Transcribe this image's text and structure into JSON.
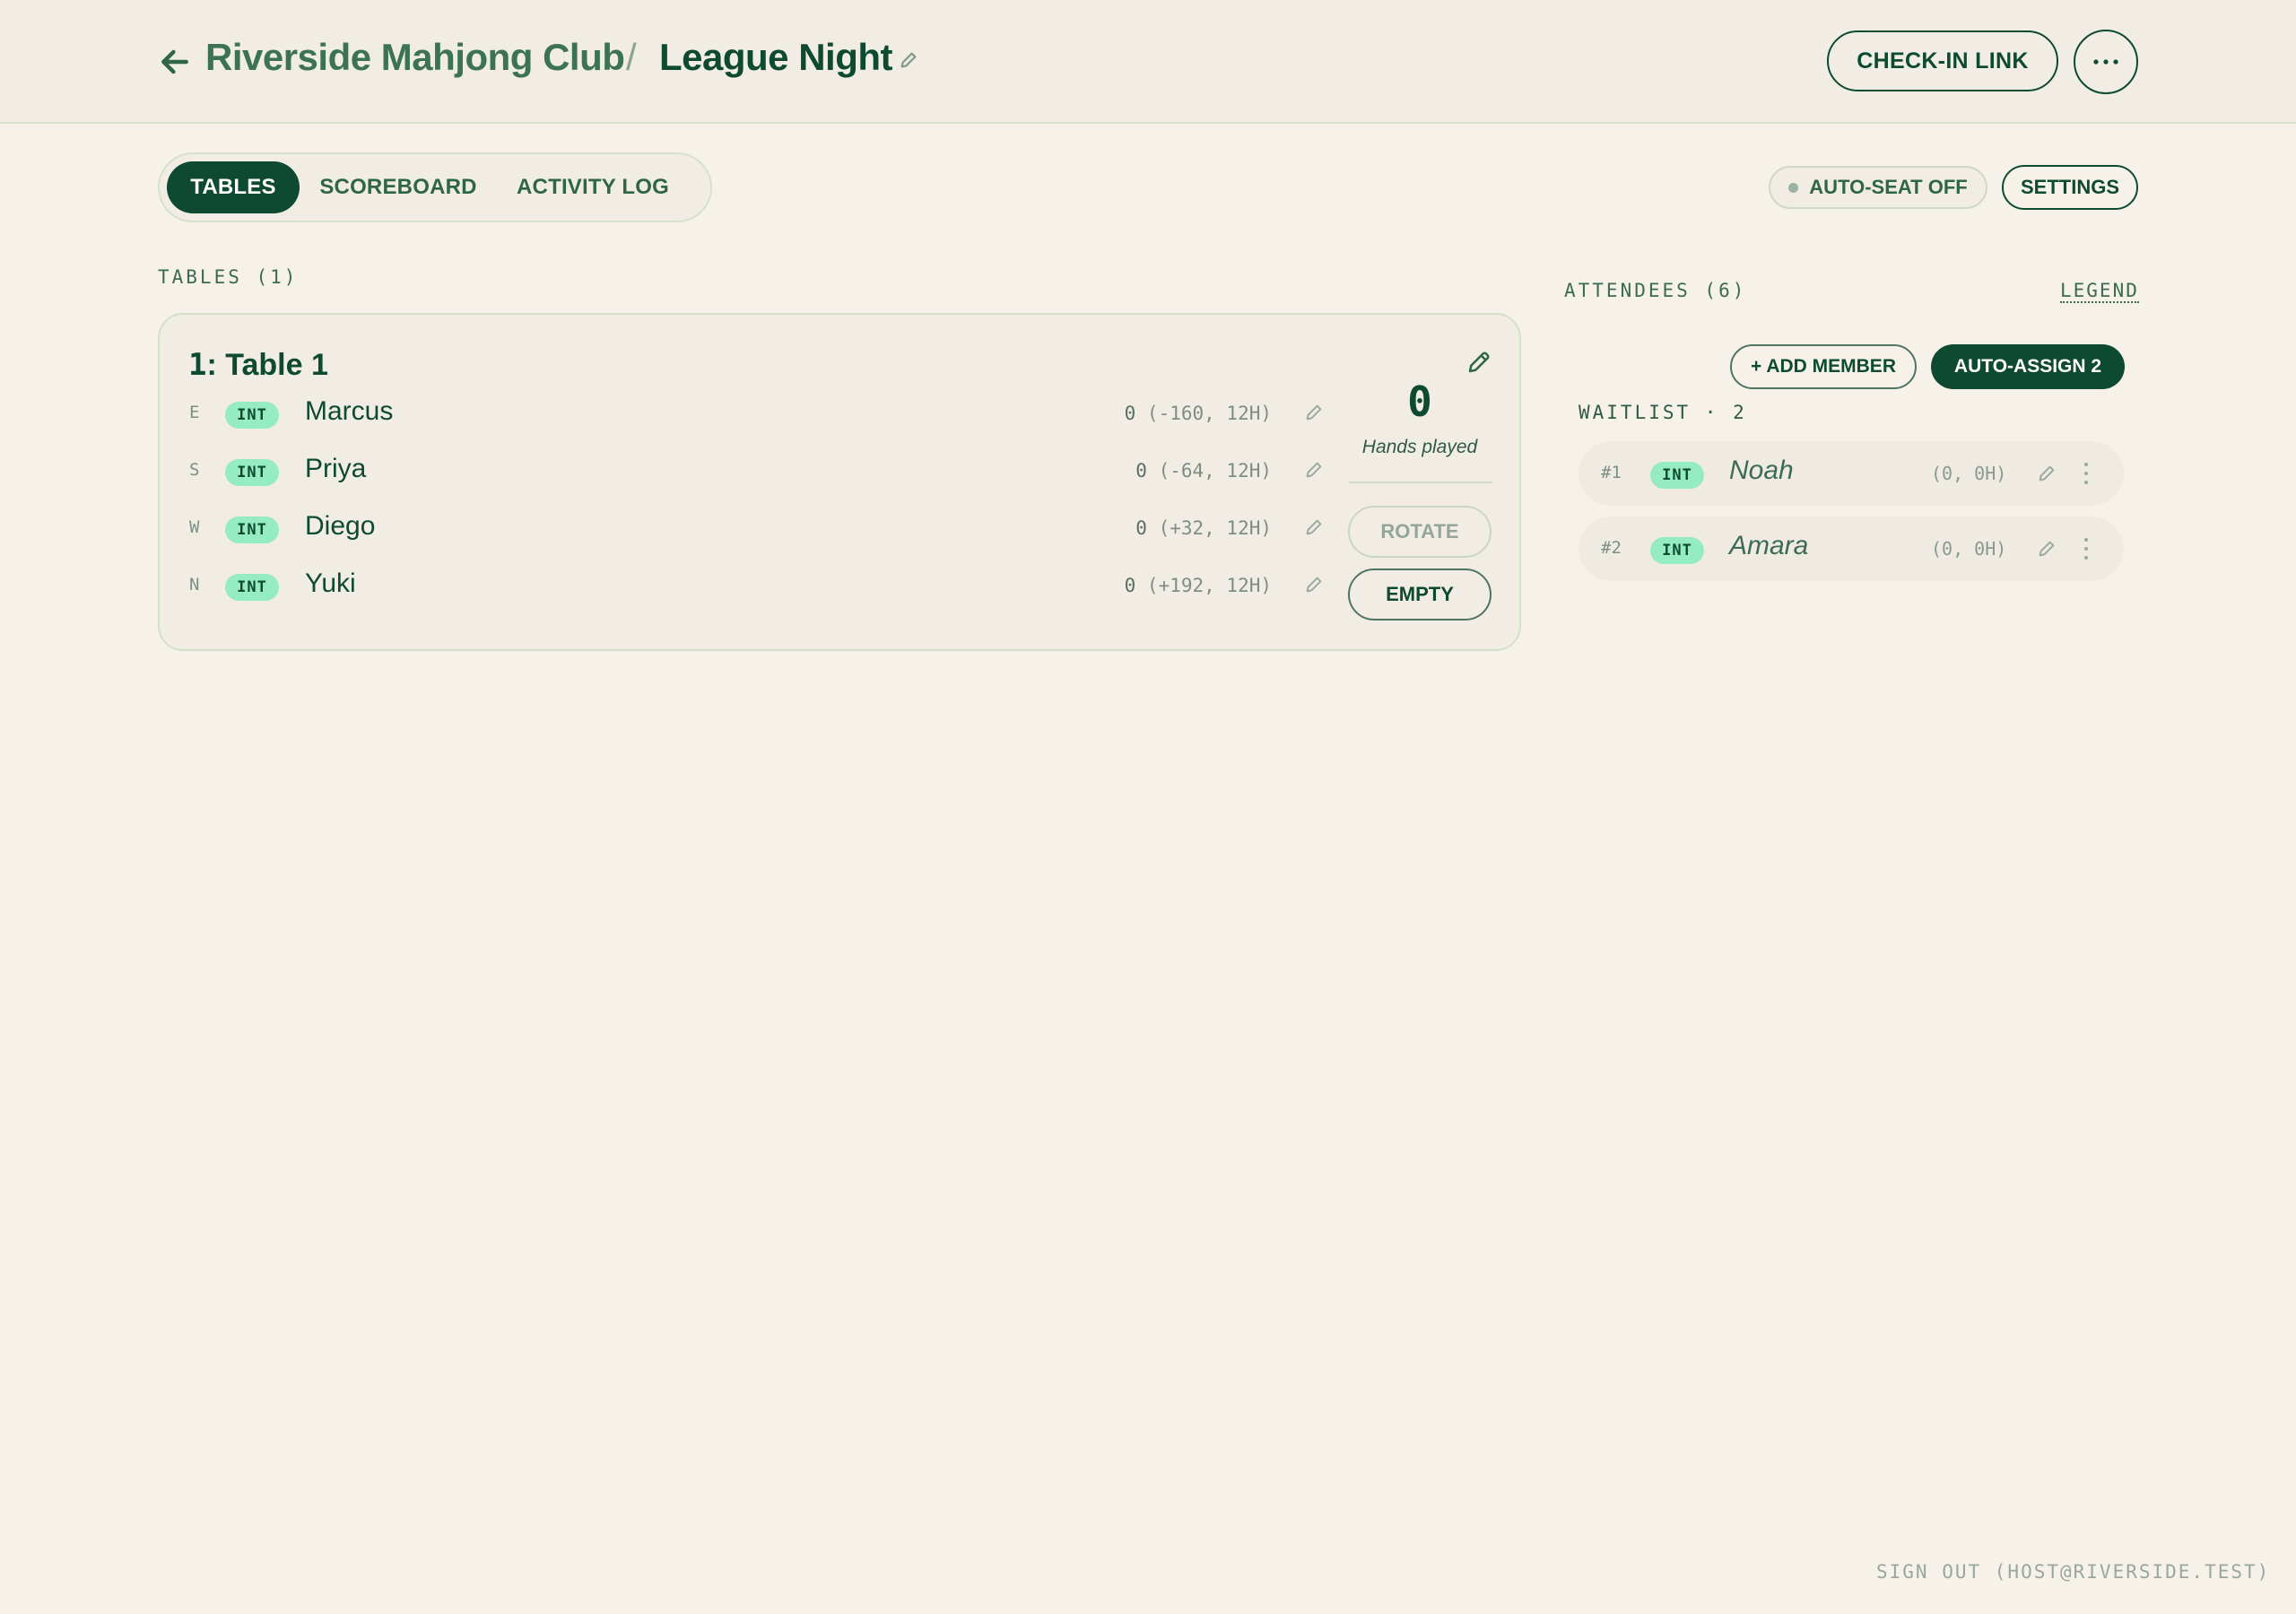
{
  "header": {
    "club_name": "Riverside Mahjong Club",
    "separator": "/",
    "event_name": "League Night",
    "checkin_label": "CHECK-IN LINK"
  },
  "tabs": [
    {
      "label": "TABLES",
      "active": true
    },
    {
      "label": "SCOREBOARD",
      "active": false
    },
    {
      "label": "ACTIVITY LOG",
      "active": false
    }
  ],
  "toolbar": {
    "autoseat_label": "AUTO-SEAT OFF",
    "settings_label": "SETTINGS"
  },
  "tables_section": {
    "label": "TABLES (1)",
    "tables": [
      {
        "number": "1",
        "name": ": Table 1",
        "hands_played": "0",
        "hands_label": "Hands played",
        "rotate_label": "ROTATE",
        "empty_label": "EMPTY",
        "seats": [
          {
            "wind": "E",
            "level": "INT",
            "name": "Marcus",
            "points": "0",
            "detail": "(-160, 12H)"
          },
          {
            "wind": "S",
            "level": "INT",
            "name": "Priya",
            "points": "0",
            "detail": "(-64, 12H)"
          },
          {
            "wind": "W",
            "level": "INT",
            "name": "Diego",
            "points": "0",
            "detail": "(+32, 12H)"
          },
          {
            "wind": "N",
            "level": "INT",
            "name": "Yuki",
            "points": "0",
            "detail": "(+192, 12H)"
          }
        ]
      }
    ]
  },
  "attendees": {
    "label": "ATTENDEES (6)",
    "legend_label": "LEGEND",
    "add_member_label": "+ ADD MEMBER",
    "auto_assign_label": "AUTO-ASSIGN 2",
    "waitlist_label": "WAITLIST · 2",
    "waitlist": [
      {
        "position": "#1",
        "level": "INT",
        "name": "Noah",
        "detail": "(0, 0H)"
      },
      {
        "position": "#2",
        "level": "INT",
        "name": "Amara",
        "detail": "(0, 0H)"
      }
    ]
  },
  "footer": {
    "signout_label": "SIGN OUT (HOST@RIVERSIDE.TEST)"
  },
  "colors": {
    "background": "#f6f2ea",
    "primary": "#0e4a31",
    "badge": "#95ecc3",
    "muted": "#7e8e84"
  },
  "icons": {
    "back": "arrow-left-icon",
    "title_edit": "pencil-icon",
    "more": "ellipsis-icon",
    "table_edit": "pencil-icon",
    "row_edit": "pencil-icon",
    "row_more": "kebab-icon"
  }
}
